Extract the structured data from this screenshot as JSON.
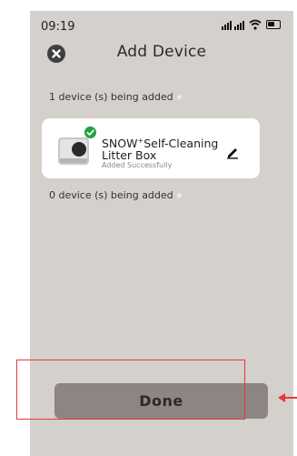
{
  "status_bar": {
    "time": "09:19"
  },
  "header": {
    "title": "Add Device"
  },
  "groups": [
    {
      "label": "1 device (s) being added"
    },
    {
      "label": "0 device (s) being added"
    }
  ],
  "device": {
    "name_prefix": "SNOW",
    "name_sup": "+",
    "name_suffix": "Self-Cleaning Litter Box",
    "status": "Added Successfully"
  },
  "footer": {
    "done_label": "Done"
  },
  "colors": {
    "background": "#d4d0cb",
    "card": "#ffffff",
    "success": "#24a246",
    "done_button": "#8c8583",
    "highlight": "#e33a3a"
  },
  "icons": [
    "close-icon",
    "edit-pencil-icon",
    "check-icon",
    "wifi-icon",
    "signal-icon",
    "battery-icon",
    "loading-icon"
  ]
}
